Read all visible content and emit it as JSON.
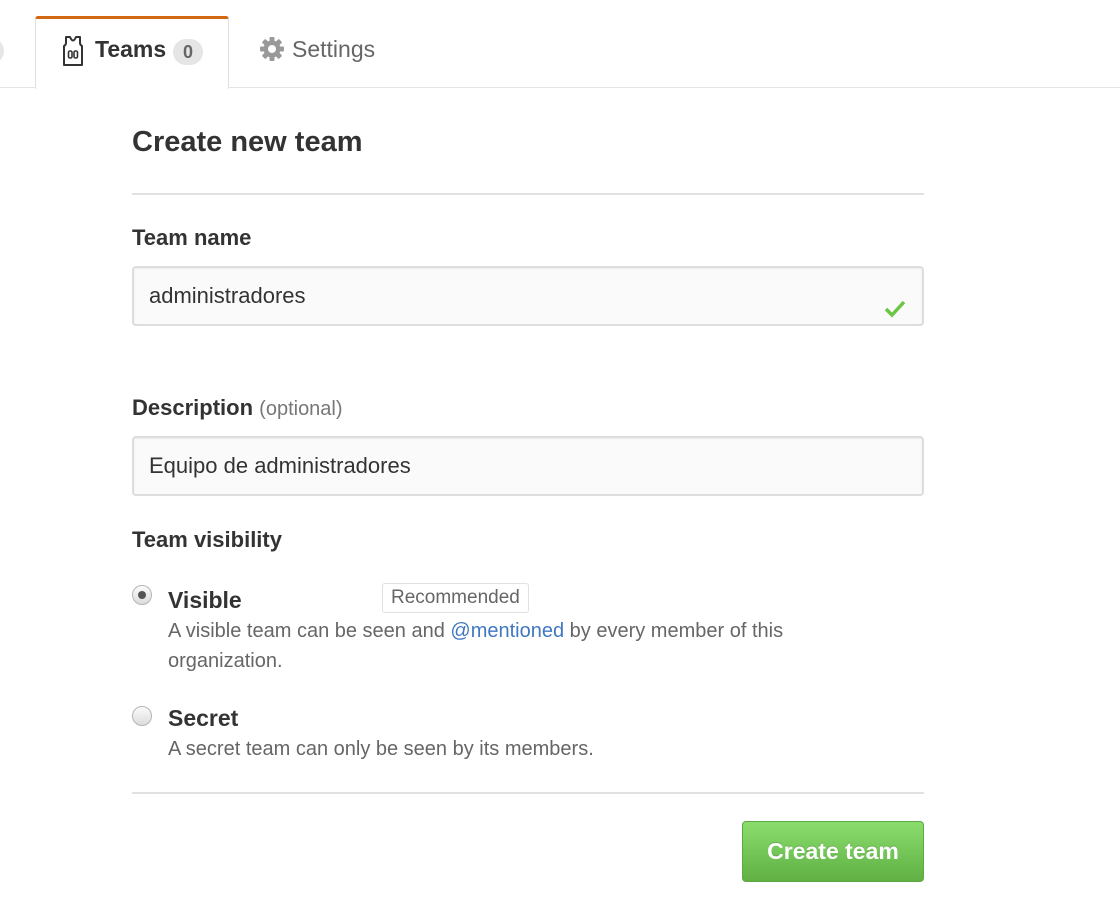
{
  "tabs": {
    "teams": {
      "label": "Teams",
      "count": "0",
      "icon": "jersey-icon"
    },
    "settings": {
      "label": "Settings",
      "icon": "gear-icon"
    },
    "active_color": "#d26911"
  },
  "form": {
    "title": "Create new team",
    "team_name": {
      "label": "Team name",
      "value": "administradores",
      "status_icon": "check-icon",
      "status_color": "#6cc644"
    },
    "description": {
      "label": "Description",
      "note": "(optional)",
      "value": "Equipo de administradores"
    },
    "visibility": {
      "label": "Team visibility",
      "options": [
        {
          "title": "Visible",
          "badge": "Recommended",
          "desc_before": "A visible team can be seen and ",
          "mention": "@mentioned",
          "desc_after": " by every member of this organization.",
          "checked": true
        },
        {
          "title": "Secret",
          "desc": "A secret team can only be seen by its members.",
          "checked": false
        }
      ]
    },
    "submit_label": "Create team",
    "submit_color": "#6cc644"
  }
}
